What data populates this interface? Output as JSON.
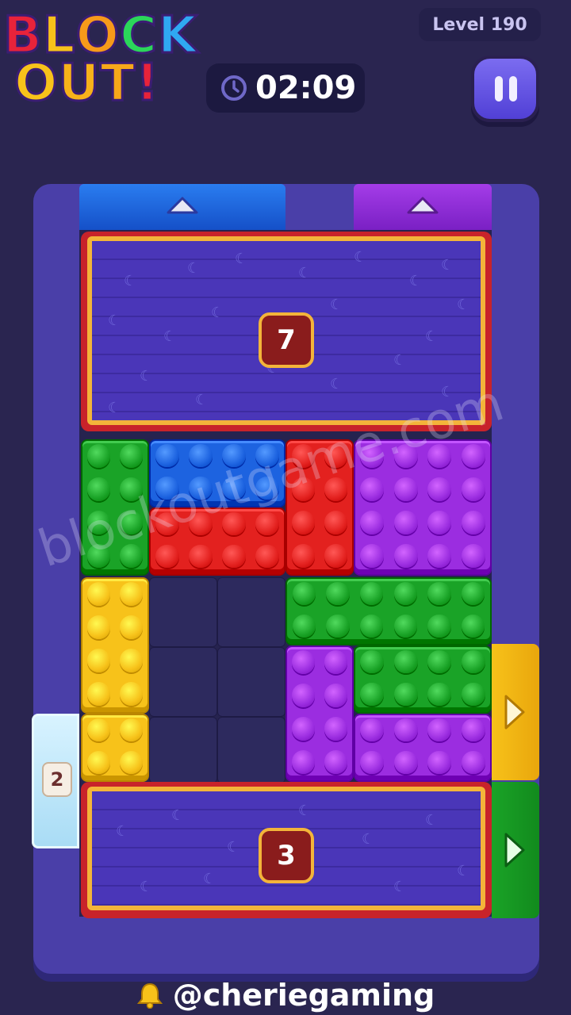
{
  "app": {
    "logo_line1": "BLOCK",
    "logo_line2": "OUT!"
  },
  "header": {
    "level_label": "Level 190",
    "timer": "02:09",
    "pause_icon": "pause-icon",
    "timer_icon": "clock-icon"
  },
  "board": {
    "top_plank_number": "7",
    "bottom_plank_number": "3",
    "ice_block_number": "2",
    "colors": {
      "green": "#1aa327",
      "blue": "#1d63e0",
      "red": "#e3211f",
      "purple": "#9b2de0",
      "yellow": "#f7c21a",
      "gold": "#f3b43a",
      "board": "#4a3fa8"
    }
  },
  "watermark": "blockoutgame.com",
  "footer": {
    "handle": "@cheriegaming",
    "icon": "bell-icon"
  }
}
